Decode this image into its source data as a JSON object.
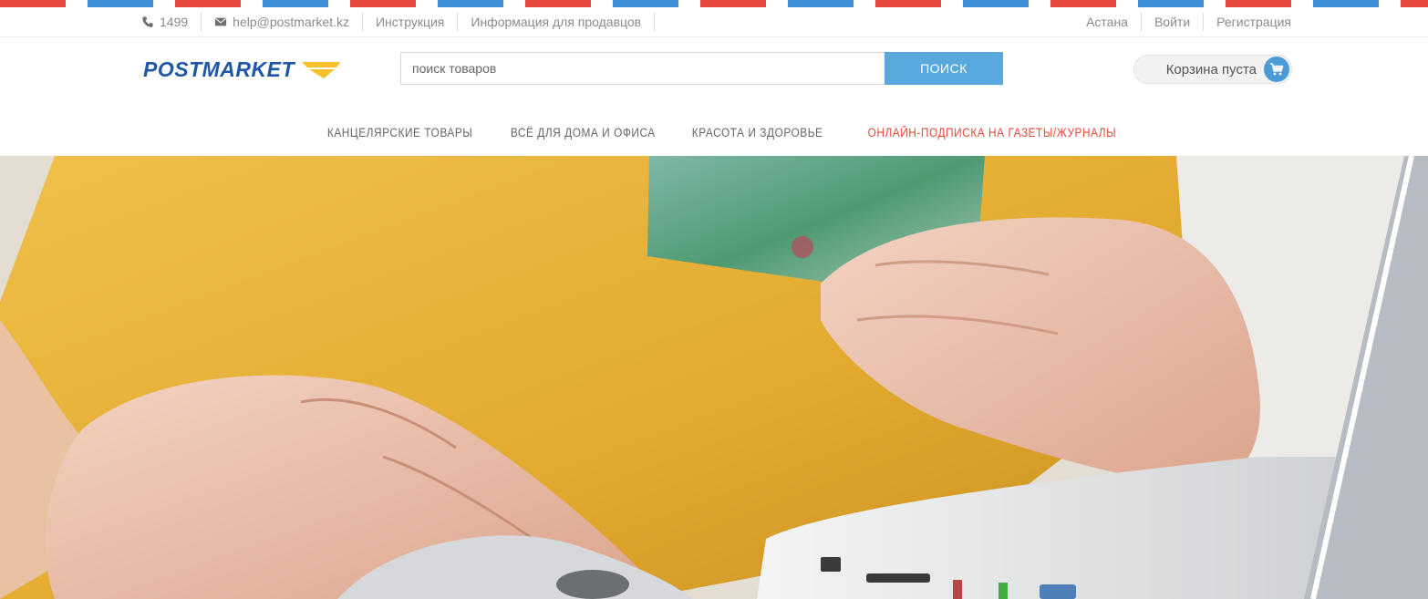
{
  "topbar": {
    "phone": "1499",
    "email": "help@postmarket.kz",
    "instructions": "Инструкция",
    "sellers_info": "Информация для продавцов",
    "city": "Астана",
    "login": "Войти",
    "register": "Регистрация"
  },
  "header": {
    "logo_text": "POSTMARKET",
    "search_placeholder": "поиск товаров",
    "search_button": "ПОИСК",
    "cart_label": "Корзина пуста"
  },
  "nav": {
    "items": [
      {
        "label": "КАНЦЕЛЯРСКИЕ ТОВАРЫ"
      },
      {
        "label": "ВСЁ ДЛЯ ДОМА И ОФИСА"
      },
      {
        "label": "КРАСОТА И ЗДОРОВЬЕ"
      },
      {
        "label": "ОНЛАЙН-ПОДПИСКА НА ГАЗЕТЫ/ЖУРНАЛЫ"
      }
    ]
  },
  "colors": {
    "brand_blue": "#1f57a8",
    "brand_yellow": "#f3c22a",
    "accent_red": "#e24a3b",
    "search_button": "#5aa9de"
  }
}
